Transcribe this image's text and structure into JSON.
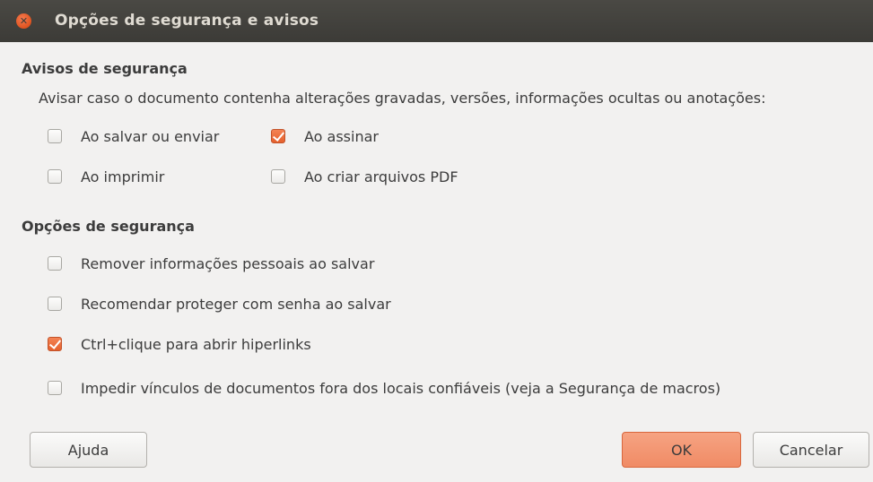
{
  "window": {
    "title": "Opções de segurança e avisos"
  },
  "security_warnings": {
    "heading": "Avisos de segurança",
    "description": "Avisar caso o documento contenha alterações gravadas, versões, informações ocultas ou anotações:",
    "options": [
      {
        "label": "Ao salvar ou enviar",
        "checked": false
      },
      {
        "label": "Ao assinar",
        "checked": true
      },
      {
        "label": "Ao imprimir",
        "checked": false
      },
      {
        "label": "Ao criar arquivos PDF",
        "checked": false
      }
    ]
  },
  "security_options": {
    "heading": "Opções de segurança",
    "options": [
      {
        "label": "Remover informações pessoais ao salvar",
        "checked": false
      },
      {
        "label": "Recomendar proteger com senha ao salvar",
        "checked": false
      },
      {
        "label": "Ctrl+clique para abrir hiperlinks",
        "checked": true
      },
      {
        "label": "Impedir vínculos de documentos fora dos locais confiáveis (veja a Segurança de macros)",
        "checked": false
      }
    ]
  },
  "buttons": {
    "help": "Ajuda",
    "ok": "OK",
    "cancel": "Cancelar"
  },
  "colors": {
    "titlebar": "#3c3b37",
    "accent": "#f08b65",
    "checked_fill": "#e5602c",
    "background": "#f2f1f0"
  },
  "icons": {
    "close": "close-icon",
    "check": "check-icon"
  }
}
